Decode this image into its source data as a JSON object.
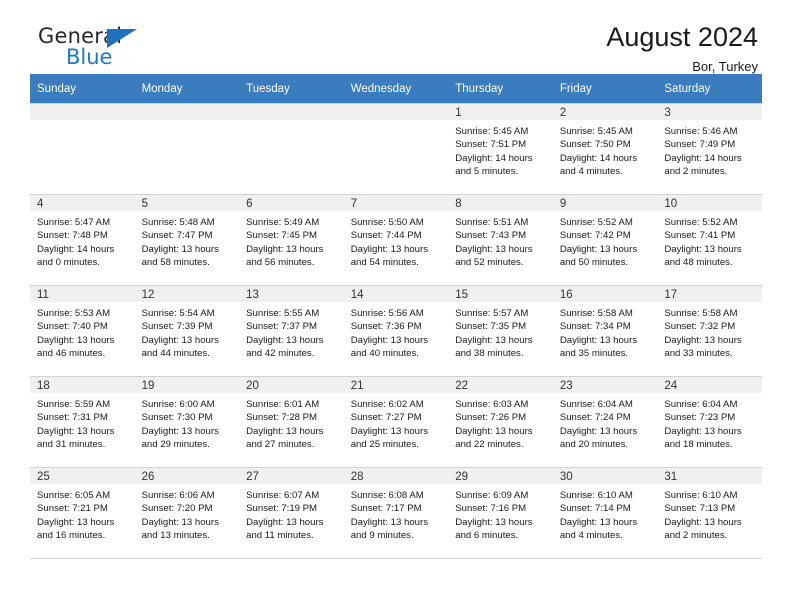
{
  "brand": {
    "name_top": "General",
    "name_bottom": "Blue",
    "triangle_color": "#1f72bb",
    "blue_color": "#1f7ac4"
  },
  "header": {
    "title": "August 2024",
    "subtitle": "Bor, Turkey"
  },
  "theme": {
    "header_blue": "#3b7cbf",
    "daynum_band": "#f0f0f0",
    "grid_line": "#d4d4d4"
  },
  "weekday_headers": [
    "Sunday",
    "Monday",
    "Tuesday",
    "Wednesday",
    "Thursday",
    "Friday",
    "Saturday"
  ],
  "labels": {
    "sunrise_prefix": "Sunrise:",
    "sunset_prefix": "Sunset:",
    "daylight_prefix": "Daylight:"
  },
  "weeks": [
    [
      {
        "day": "",
        "empty": true
      },
      {
        "day": "",
        "empty": true
      },
      {
        "day": "",
        "empty": true
      },
      {
        "day": "",
        "empty": true
      },
      {
        "day": "1",
        "sunrise": "Sunrise: 5:45 AM",
        "sunset": "Sunset: 7:51 PM",
        "daylight_1": "Daylight: 14 hours",
        "daylight_2": "and 5 minutes."
      },
      {
        "day": "2",
        "sunrise": "Sunrise: 5:45 AM",
        "sunset": "Sunset: 7:50 PM",
        "daylight_1": "Daylight: 14 hours",
        "daylight_2": "and 4 minutes."
      },
      {
        "day": "3",
        "sunrise": "Sunrise: 5:46 AM",
        "sunset": "Sunset: 7:49 PM",
        "daylight_1": "Daylight: 14 hours",
        "daylight_2": "and 2 minutes."
      }
    ],
    [
      {
        "day": "4",
        "sunrise": "Sunrise: 5:47 AM",
        "sunset": "Sunset: 7:48 PM",
        "daylight_1": "Daylight: 14 hours",
        "daylight_2": "and 0 minutes."
      },
      {
        "day": "5",
        "sunrise": "Sunrise: 5:48 AM",
        "sunset": "Sunset: 7:47 PM",
        "daylight_1": "Daylight: 13 hours",
        "daylight_2": "and 58 minutes."
      },
      {
        "day": "6",
        "sunrise": "Sunrise: 5:49 AM",
        "sunset": "Sunset: 7:45 PM",
        "daylight_1": "Daylight: 13 hours",
        "daylight_2": "and 56 minutes."
      },
      {
        "day": "7",
        "sunrise": "Sunrise: 5:50 AM",
        "sunset": "Sunset: 7:44 PM",
        "daylight_1": "Daylight: 13 hours",
        "daylight_2": "and 54 minutes."
      },
      {
        "day": "8",
        "sunrise": "Sunrise: 5:51 AM",
        "sunset": "Sunset: 7:43 PM",
        "daylight_1": "Daylight: 13 hours",
        "daylight_2": "and 52 minutes."
      },
      {
        "day": "9",
        "sunrise": "Sunrise: 5:52 AM",
        "sunset": "Sunset: 7:42 PM",
        "daylight_1": "Daylight: 13 hours",
        "daylight_2": "and 50 minutes."
      },
      {
        "day": "10",
        "sunrise": "Sunrise: 5:52 AM",
        "sunset": "Sunset: 7:41 PM",
        "daylight_1": "Daylight: 13 hours",
        "daylight_2": "and 48 minutes."
      }
    ],
    [
      {
        "day": "11",
        "sunrise": "Sunrise: 5:53 AM",
        "sunset": "Sunset: 7:40 PM",
        "daylight_1": "Daylight: 13 hours",
        "daylight_2": "and 46 minutes."
      },
      {
        "day": "12",
        "sunrise": "Sunrise: 5:54 AM",
        "sunset": "Sunset: 7:39 PM",
        "daylight_1": "Daylight: 13 hours",
        "daylight_2": "and 44 minutes."
      },
      {
        "day": "13",
        "sunrise": "Sunrise: 5:55 AM",
        "sunset": "Sunset: 7:37 PM",
        "daylight_1": "Daylight: 13 hours",
        "daylight_2": "and 42 minutes."
      },
      {
        "day": "14",
        "sunrise": "Sunrise: 5:56 AM",
        "sunset": "Sunset: 7:36 PM",
        "daylight_1": "Daylight: 13 hours",
        "daylight_2": "and 40 minutes."
      },
      {
        "day": "15",
        "sunrise": "Sunrise: 5:57 AM",
        "sunset": "Sunset: 7:35 PM",
        "daylight_1": "Daylight: 13 hours",
        "daylight_2": "and 38 minutes."
      },
      {
        "day": "16",
        "sunrise": "Sunrise: 5:58 AM",
        "sunset": "Sunset: 7:34 PM",
        "daylight_1": "Daylight: 13 hours",
        "daylight_2": "and 35 minutes."
      },
      {
        "day": "17",
        "sunrise": "Sunrise: 5:58 AM",
        "sunset": "Sunset: 7:32 PM",
        "daylight_1": "Daylight: 13 hours",
        "daylight_2": "and 33 minutes."
      }
    ],
    [
      {
        "day": "18",
        "sunrise": "Sunrise: 5:59 AM",
        "sunset": "Sunset: 7:31 PM",
        "daylight_1": "Daylight: 13 hours",
        "daylight_2": "and 31 minutes."
      },
      {
        "day": "19",
        "sunrise": "Sunrise: 6:00 AM",
        "sunset": "Sunset: 7:30 PM",
        "daylight_1": "Daylight: 13 hours",
        "daylight_2": "and 29 minutes."
      },
      {
        "day": "20",
        "sunrise": "Sunrise: 6:01 AM",
        "sunset": "Sunset: 7:28 PM",
        "daylight_1": "Daylight: 13 hours",
        "daylight_2": "and 27 minutes."
      },
      {
        "day": "21",
        "sunrise": "Sunrise: 6:02 AM",
        "sunset": "Sunset: 7:27 PM",
        "daylight_1": "Daylight: 13 hours",
        "daylight_2": "and 25 minutes."
      },
      {
        "day": "22",
        "sunrise": "Sunrise: 6:03 AM",
        "sunset": "Sunset: 7:26 PM",
        "daylight_1": "Daylight: 13 hours",
        "daylight_2": "and 22 minutes."
      },
      {
        "day": "23",
        "sunrise": "Sunrise: 6:04 AM",
        "sunset": "Sunset: 7:24 PM",
        "daylight_1": "Daylight: 13 hours",
        "daylight_2": "and 20 minutes."
      },
      {
        "day": "24",
        "sunrise": "Sunrise: 6:04 AM",
        "sunset": "Sunset: 7:23 PM",
        "daylight_1": "Daylight: 13 hours",
        "daylight_2": "and 18 minutes."
      }
    ],
    [
      {
        "day": "25",
        "sunrise": "Sunrise: 6:05 AM",
        "sunset": "Sunset: 7:21 PM",
        "daylight_1": "Daylight: 13 hours",
        "daylight_2": "and 16 minutes."
      },
      {
        "day": "26",
        "sunrise": "Sunrise: 6:06 AM",
        "sunset": "Sunset: 7:20 PM",
        "daylight_1": "Daylight: 13 hours",
        "daylight_2": "and 13 minutes."
      },
      {
        "day": "27",
        "sunrise": "Sunrise: 6:07 AM",
        "sunset": "Sunset: 7:19 PM",
        "daylight_1": "Daylight: 13 hours",
        "daylight_2": "and 11 minutes."
      },
      {
        "day": "28",
        "sunrise": "Sunrise: 6:08 AM",
        "sunset": "Sunset: 7:17 PM",
        "daylight_1": "Daylight: 13 hours",
        "daylight_2": "and 9 minutes."
      },
      {
        "day": "29",
        "sunrise": "Sunrise: 6:09 AM",
        "sunset": "Sunset: 7:16 PM",
        "daylight_1": "Daylight: 13 hours",
        "daylight_2": "and 6 minutes."
      },
      {
        "day": "30",
        "sunrise": "Sunrise: 6:10 AM",
        "sunset": "Sunset: 7:14 PM",
        "daylight_1": "Daylight: 13 hours",
        "daylight_2": "and 4 minutes."
      },
      {
        "day": "31",
        "sunrise": "Sunrise: 6:10 AM",
        "sunset": "Sunset: 7:13 PM",
        "daylight_1": "Daylight: 13 hours",
        "daylight_2": "and 2 minutes."
      }
    ]
  ]
}
